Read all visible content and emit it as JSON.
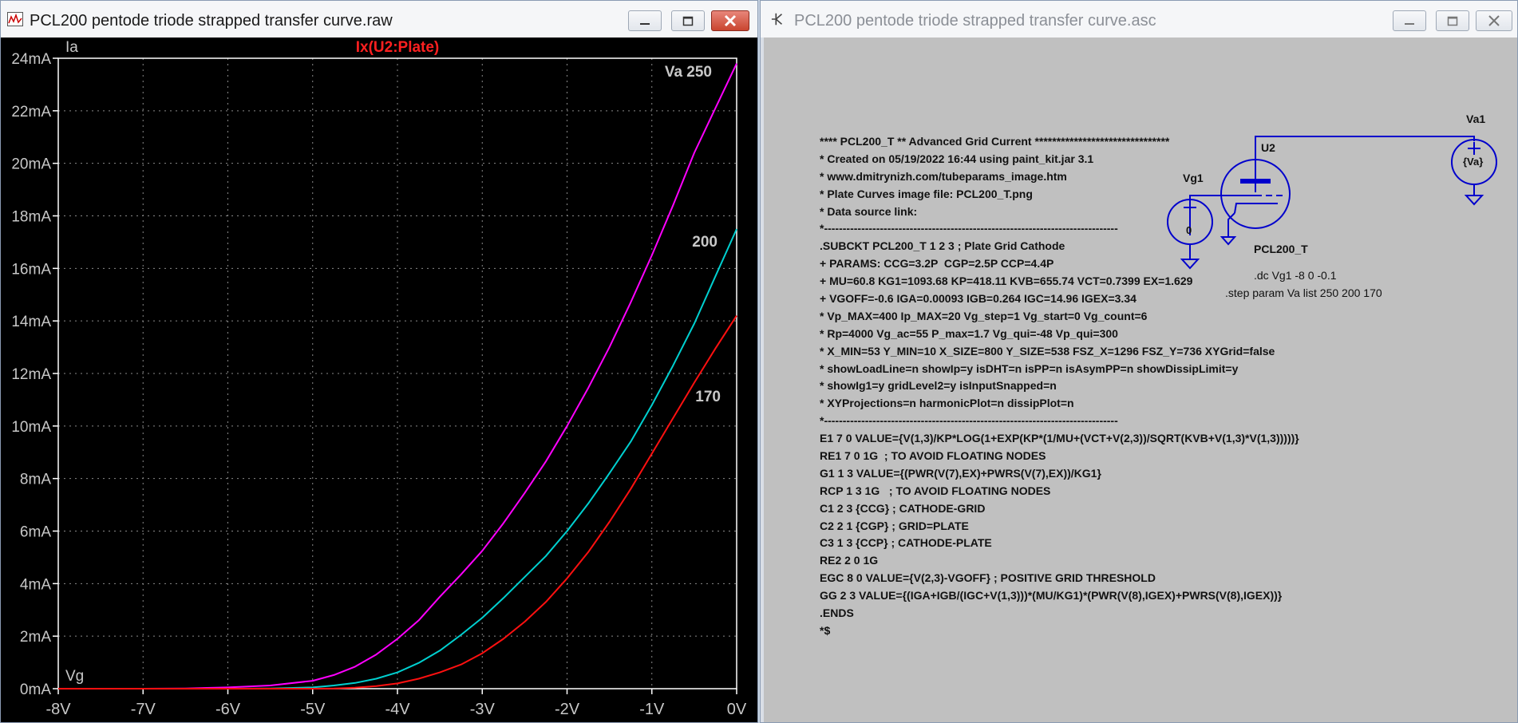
{
  "left_window": {
    "title": "PCL200 pentode triode strapped transfer curve.raw",
    "controls": {
      "minimize": "minimize",
      "maximize": "maximize",
      "close": "close"
    }
  },
  "right_window": {
    "title": "PCL200 pentode triode strapped transfer curve.asc"
  },
  "plot": {
    "trace_label": "Ix(U2:Plate)",
    "y_axis_name": "Ia",
    "x_axis_name": "Vg",
    "colors": {
      "background": "#000000",
      "grid": "#8a8a8a",
      "axis": "#ffffff",
      "text": "#c8c8c8",
      "title": "#ff2020"
    }
  },
  "chart_data": {
    "type": "line",
    "title": "Ix(U2:Plate)",
    "xlabel": "Vg",
    "ylabel": "Ia",
    "xlim": [
      -8,
      0
    ],
    "ylim": [
      0,
      24
    ],
    "x_ticks": [
      "-8V",
      "-7V",
      "-6V",
      "-5V",
      "-4V",
      "-3V",
      "-2V",
      "-1V",
      "0V"
    ],
    "y_ticks": [
      "0mA",
      "2mA",
      "4mA",
      "6mA",
      "8mA",
      "10mA",
      "12mA",
      "14mA",
      "16mA",
      "18mA",
      "20mA",
      "22mA",
      "24mA"
    ],
    "grid": true,
    "x": [
      -8,
      -7,
      -6.5,
      -6,
      -5.5,
      -5,
      -4.75,
      -4.5,
      -4.25,
      -4,
      -3.75,
      -3.5,
      -3.25,
      -3,
      -2.75,
      -2.5,
      -2.25,
      -2,
      -1.75,
      -1.5,
      -1.25,
      -1,
      -0.75,
      -0.5,
      -0.25,
      0
    ],
    "series": [
      {
        "name": "Va 250",
        "label": "Va 250",
        "color": "#ff00ff",
        "values": [
          0,
          0,
          0.01,
          0.05,
          0.12,
          0.3,
          0.52,
          0.84,
          1.3,
          1.9,
          2.6,
          3.5,
          4.35,
          5.25,
          6.3,
          7.45,
          8.65,
          10.0,
          11.45,
          13.0,
          14.7,
          16.5,
          18.4,
          20.4,
          22.1,
          23.8
        ]
      },
      {
        "name": "Va 200",
        "label": "200",
        "color": "#00d0d0",
        "values": [
          0,
          0,
          0,
          0,
          0.01,
          0.05,
          0.12,
          0.22,
          0.38,
          0.62,
          0.98,
          1.45,
          2.05,
          2.7,
          3.45,
          4.25,
          5.05,
          6.0,
          7.05,
          8.2,
          9.4,
          10.8,
          12.3,
          13.9,
          15.7,
          17.5
        ]
      },
      {
        "name": "Va 170",
        "label": "170",
        "color": "#ff1010",
        "values": [
          0,
          0,
          0,
          0,
          0,
          0,
          0.01,
          0.04,
          0.1,
          0.2,
          0.38,
          0.62,
          0.92,
          1.35,
          1.9,
          2.55,
          3.3,
          4.2,
          5.2,
          6.35,
          7.6,
          8.95,
          10.3,
          11.65,
          12.95,
          14.2
        ]
      }
    ]
  },
  "netlist": {
    "lines": [
      "**** PCL200_T ** Advanced Grid Current *******************************",
      "* Created on 05/19/2022 16:44 using paint_kit.jar 3.1",
      "* www.dmitrynizh.com/tubeparams_image.htm",
      "* Plate Curves image file: PCL200_T.png",
      "* Data source link:",
      "*-------------------------------------------------------------------------------",
      ".SUBCKT PCL200_T 1 2 3 ; Plate Grid Cathode",
      "+ PARAMS: CCG=3.2P  CGP=2.5P CCP=4.4P",
      "+ MU=60.8 KG1=1093.68 KP=418.11 KVB=655.74 VCT=0.7399 EX=1.629",
      "+ VGOFF=-0.6 IGA=0.00093 IGB=0.264 IGC=14.96 IGEX=3.34",
      "* Vp_MAX=400 Ip_MAX=20 Vg_step=1 Vg_start=0 Vg_count=6",
      "* Rp=4000 Vg_ac=55 P_max=1.7 Vg_qui=-48 Vp_qui=300",
      "* X_MIN=53 Y_MIN=10 X_SIZE=800 Y_SIZE=538 FSZ_X=1296 FSZ_Y=736 XYGrid=false",
      "* showLoadLine=n showIp=y isDHT=n isPP=n isAsymPP=n showDissipLimit=y",
      "* showIg1=y gridLevel2=y isInputSnapped=n",
      "* XYProjections=n harmonicPlot=n dissipPlot=n",
      "*-------------------------------------------------------------------------------",
      "E1 7 0 VALUE={V(1,3)/KP*LOG(1+EXP(KP*(1/MU+(VCT+V(2,3))/SQRT(KVB+V(1,3)*V(1,3)))))}",
      "RE1 7 0 1G  ; TO AVOID FLOATING NODES",
      "G1 1 3 VALUE={(PWR(V(7),EX)+PWRS(V(7),EX))/KG1}",
      "RCP 1 3 1G   ; TO AVOID FLOATING NODES",
      "C1 2 3 {CCG} ; CATHODE-GRID",
      "C2 2 1 {CGP} ; GRID=PLATE",
      "C3 1 3 {CCP} ; CATHODE-PLATE",
      "RE2 2 0 1G",
      "EGC 8 0 VALUE={V(2,3)-VGOFF} ; POSITIVE GRID THRESHOLD",
      "GG 2 3 VALUE={(IGA+IGB/(IGC+V(1,3)))*(MU/KG1)*(PWR(V(8),IGEX)+PWRS(V(8),IGEX))}",
      ".ENDS",
      "*$"
    ]
  },
  "schematic": {
    "va1_label": "Va1",
    "va1_value": "{Va}",
    "vg1_label": "Vg1",
    "vg1_value": "0",
    "tube_ref": "U2",
    "tube_model": "PCL200_T",
    "dc_directive": ".dc Vg1 -8 0 -0.1",
    "step_directive": ".step param Va  list 250 200 170",
    "wire_color": "#0000cc"
  }
}
